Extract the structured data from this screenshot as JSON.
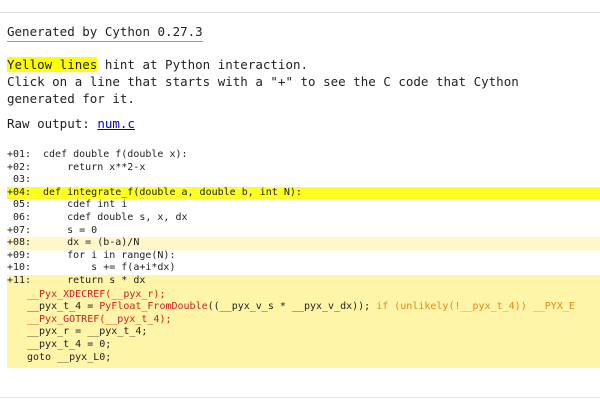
{
  "header": {
    "generated": "Generated by Cython 0.27.3"
  },
  "hint": {
    "highlight": "Yellow lines",
    "rest1": " hint at Python interaction.",
    "line2": "Click on a line that starts with a \"+\" to see the C code that Cython",
    "line3": "generated for it."
  },
  "raw": {
    "label": "Raw output: ",
    "link": "num.c"
  },
  "code_lines": [
    {
      "num": "+01:",
      "text": " cdef double f(double x):",
      "level": 0
    },
    {
      "num": "+02:",
      "text": "     return x**2-x",
      "level": 0
    },
    {
      "num": " 03:",
      "text": "",
      "level": 0
    },
    {
      "num": "+04:",
      "text": " def integrate_f(double a, double b, int N):",
      "level": 2
    },
    {
      "num": " 05:",
      "text": "     cdef int i",
      "level": 0
    },
    {
      "num": " 06:",
      "text": "     cdef double s, x, dx",
      "level": 0
    },
    {
      "num": "+07:",
      "text": "     s = 0",
      "level": 0
    },
    {
      "num": "+08:",
      "text": "     dx = (b-a)/N",
      "level": 1
    },
    {
      "num": "+09:",
      "text": "     for i in range(N):",
      "level": 0
    },
    {
      "num": "+10:",
      "text": "         s += f(a+i*dx)",
      "level": 0
    },
    {
      "num": "+11:",
      "text": "     return s * dx",
      "level": 3
    }
  ],
  "expanded_c": {
    "l1": "__Pyx_XDECREF(__pyx_r);",
    "l2_a": "__pyx_t_4 = ",
    "l2_fn": "PyFloat_FromDouble",
    "l2_b": "((__pyx_v_s * __pyx_v_dx)); ",
    "l2_c": "if (unlikely(!__pyx_t_4)) __PYX_E",
    "l3": "__Pyx_GOTREF(__pyx_t_4);",
    "l4": "__pyx_r = __pyx_t_4;",
    "l5": "__pyx_t_4 = 0;",
    "l6": "goto __pyx_L0;"
  }
}
